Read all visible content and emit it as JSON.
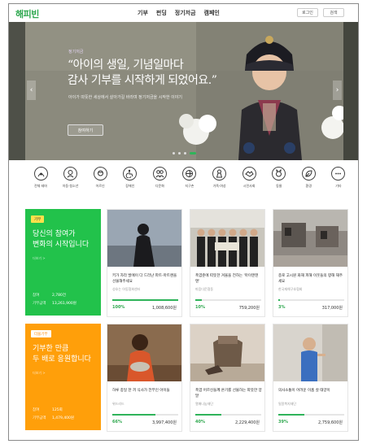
{
  "header": {
    "logo": "해피빈",
    "nav": [
      "기부",
      "펀딩",
      "정기저금",
      "캠페인"
    ],
    "login": "로그인",
    "search": "검색"
  },
  "hero": {
    "eyebrow": "정기저금",
    "title_line1": "“아이의 생일, 기념일마다",
    "title_line2": "감사 기부를 시작하게 되었어요.”",
    "subtitle": "아이가 따뜻한 세상에서 살아가길 바라며 정기저금을 시작한 이야기",
    "cta": "참여하기",
    "slide_count": 4,
    "active_slide": 4
  },
  "categories": [
    {
      "label": "전체 테마",
      "icon": "all-themes-icon"
    },
    {
      "label": "아동·청소년",
      "icon": "child-icon"
    },
    {
      "label": "어르신",
      "icon": "senior-icon"
    },
    {
      "label": "장애인",
      "icon": "disability-icon"
    },
    {
      "label": "다문화",
      "icon": "multicultural-icon"
    },
    {
      "label": "지구촌",
      "icon": "globe-icon"
    },
    {
      "label": "가족·여성",
      "icon": "family-icon"
    },
    {
      "label": "시민사회",
      "icon": "handshake-icon"
    },
    {
      "label": "동물",
      "icon": "animal-icon"
    },
    {
      "label": "환경",
      "icon": "leaf-icon"
    },
    {
      "label": "기타",
      "icon": "more-icon"
    }
  ],
  "panels": [
    {
      "badge": "기부",
      "title_line1": "당신의 참여가",
      "title_line2": "변화의 시작입니다",
      "more": "더보기 >",
      "stat1_label": "참여",
      "stat1_value": "2,780건",
      "stat2_label": "기부금액",
      "stat2_value": "13,261,900원",
      "bg": "#22c24b",
      "badge_bg": "#ffe14b",
      "badge_color": "#333333"
    },
    {
      "badge": "더블기부",
      "title_line1": "기부한 만큼",
      "title_line2": "두 배로 응원합니다",
      "more": "더보기 >",
      "stat1_label": "참여",
      "stat1_value": "125회",
      "stat2_label": "기부금액",
      "stat2_value": "1,479,400원",
      "bg": "#ff9f0a",
      "badge_bg": "#ffffff",
      "badge_color": "#ff8a00"
    }
  ],
  "cards": [
    {
      "title": "키가 자라 발에이 다 드러난 파트-마트랜을 선물해주세요",
      "org": "성호는 아동협회센터",
      "percent": "100%",
      "fill": 1.0,
      "amount": "1,008,600원"
    },
    {
      "title": "폭염준에 따뜻한 겨울을 전하는 '마이엔텐텐'",
      "org": "마음다운협동",
      "percent": "10%",
      "fill": 0.1,
      "amount": "759,200원"
    },
    {
      "title": "종로 고시원 화재 피해 이웃들의 향해 재주세요",
      "org": "한국재해구호협회",
      "percent": "3%",
      "fill": 0.03,
      "amount": "317,000원"
    },
    {
      "title": "하루 종일 한 끼 식사가 전부인 아이들",
      "org": "위드리드",
      "percent": "66%",
      "fill": 0.66,
      "amount": "3,997,400원"
    },
    {
      "title": "폭염 어르신들께 온기를 선물하는 따뜻한 양말",
      "org": "열매나눔재단",
      "percent": "40%",
      "fill": 0.4,
      "amount": "2,229,400원"
    },
    {
      "title": "의사소통이 어려운 이홉 살 태양이",
      "org": "밀알복지재단",
      "percent": "39%",
      "fill": 0.39,
      "amount": "2,759,600원"
    }
  ],
  "colors": {
    "brand_green": "#2fa84f",
    "progress_green": "#2fb45a",
    "orange": "#ff9f0a"
  }
}
